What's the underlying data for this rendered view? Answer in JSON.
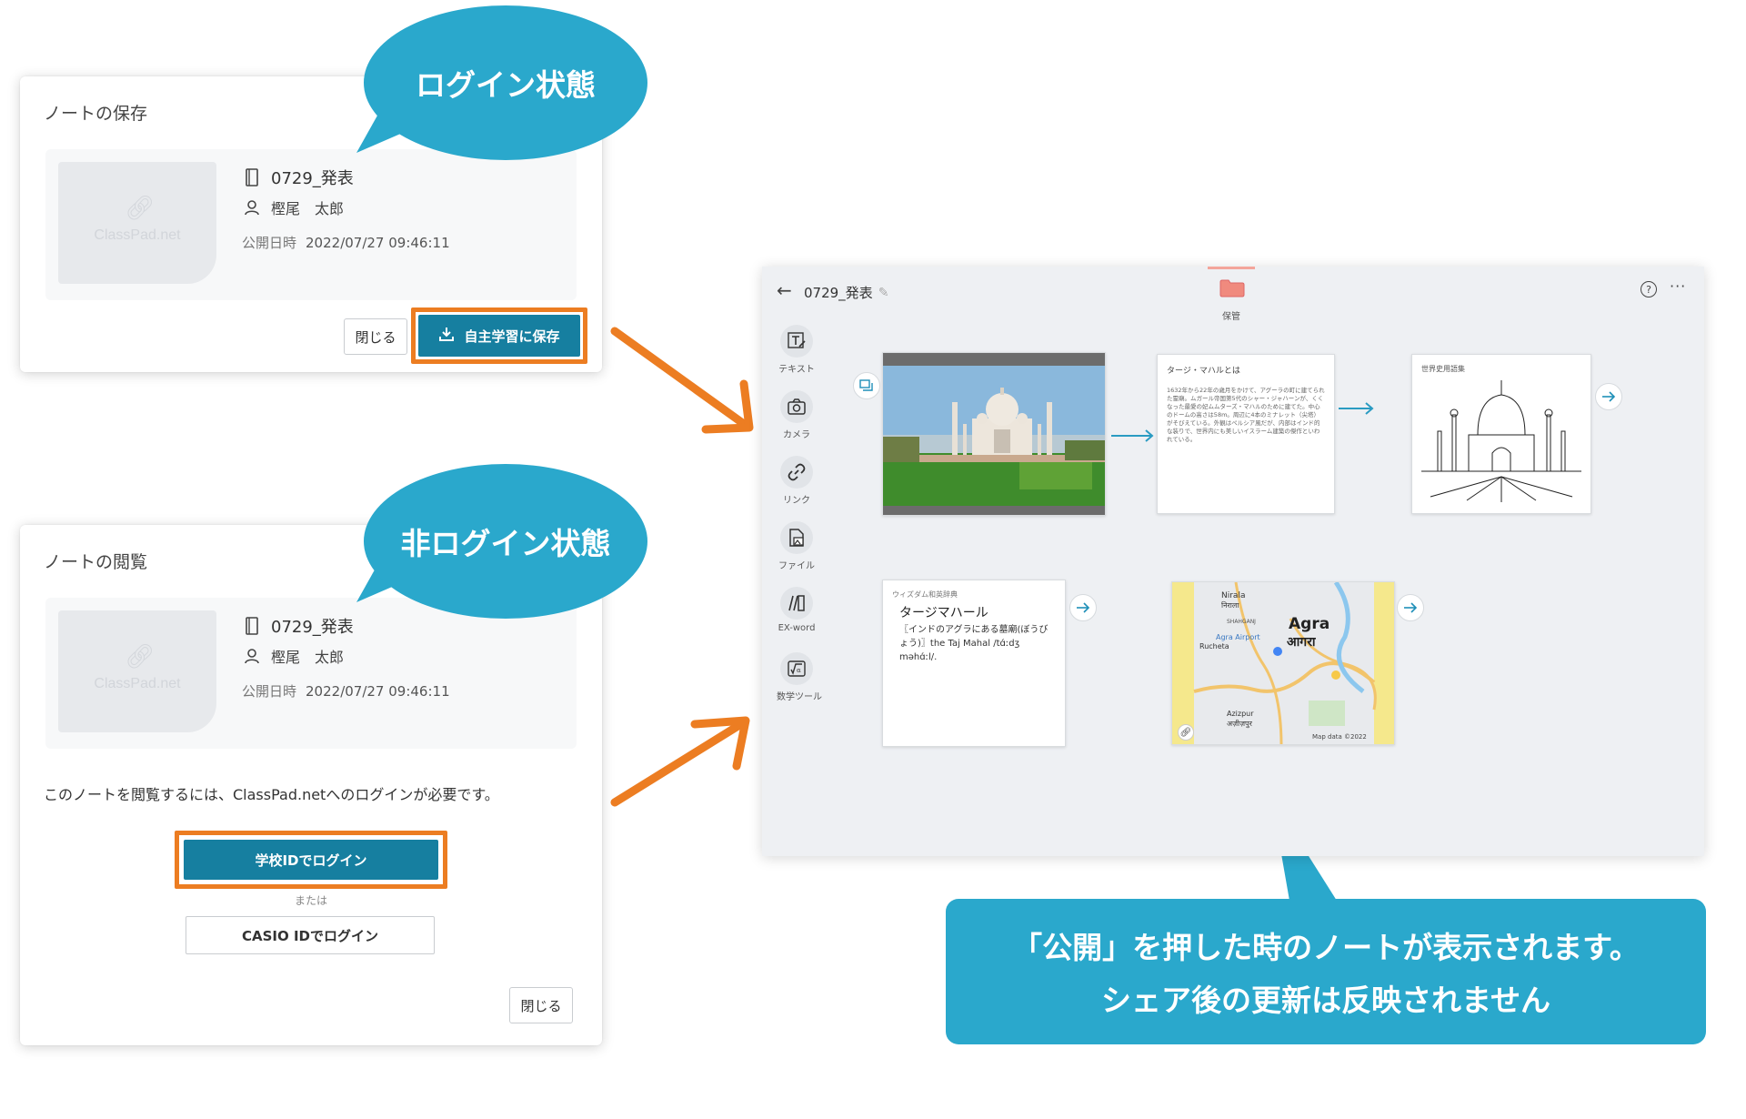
{
  "save_dialog": {
    "title": "ノートの保存",
    "note_title": "0729_発表",
    "author": "樫尾　太郎",
    "date_label": "公開日時",
    "date_value": "2022/07/27 09:46:11",
    "thumb_text": "ClassPad.net",
    "close_label": "閉じる",
    "save_label": "自主学習に保存"
  },
  "view_dialog": {
    "title": "ノートの閲覧",
    "note_title": "0729_発表",
    "author": "樫尾　太郎",
    "date_label": "公開日時",
    "date_value": "2022/07/27 09:46:11",
    "thumb_text": "ClassPad.net",
    "message": "このノートを閲覧するには、ClassPad.netへのログインが必要です。",
    "school_login_label": "学校IDでログイン",
    "or_label": "または",
    "casio_login_label": "CASIO IDでログイン",
    "close_label": "閉じる"
  },
  "bubbles": {
    "logged_in": "ログイン状態",
    "not_logged_in": "非ログイン状態"
  },
  "app": {
    "title": "0729_発表",
    "folder_label": "保管",
    "help": "?",
    "more": "···",
    "tools": [
      {
        "label": "テキスト",
        "icon": "text-icon"
      },
      {
        "label": "カメラ",
        "icon": "camera-icon"
      },
      {
        "label": "リンク",
        "icon": "link-icon"
      },
      {
        "label": "ファイル",
        "icon": "file-icon"
      },
      {
        "label": "EX-word",
        "icon": "dictionary-icon"
      },
      {
        "label": "数学ツール",
        "icon": "math-tool-icon"
      }
    ],
    "text_card": {
      "title": "タージ・マハルとは",
      "body": "1632年から22年の歳月をかけて、アグーラの町に建てられた霊廟。ムガール帝国第5代のシャー・ジャハーンが、くくなった最愛の妃ムムターズ・マハルのために建てた。中心のドームの高さは58m。周辺に4本のミナレット（尖塔）がそびえている。外観はペルシア風だが、内部はインド的な装りで、世界内にも美しいイスラーム建築の傑作といわれている。"
    },
    "sketch_card": {
      "title": "世界史用語集"
    },
    "dict_card": {
      "source": "ウィズダム和英辞典",
      "headword": "タージマハール",
      "definition": "〖インドのアグラにある墓廟(ぼうびょう)〗the Taj Mahal /tɑ́ːdʒ məhɑ́ːl/."
    },
    "map_card": {
      "city_en": "Agra",
      "city_hi": "आगरा",
      "labels": [
        "Nirala",
        "निराला",
        "SHAHGANJ",
        "Agra Airport",
        "Rucheta",
        "Azizpur",
        "अज़ीज़पुर"
      ],
      "credit": "Map data ©2022"
    }
  },
  "callout": {
    "line1": "「公開」を押した時のノートが表示されます。",
    "line2": "シェア後の更新は反映されません"
  },
  "colors": {
    "accent_blue": "#2aa8cc",
    "button_blue": "#167fa0",
    "highlight_orange": "#ec7d22"
  }
}
